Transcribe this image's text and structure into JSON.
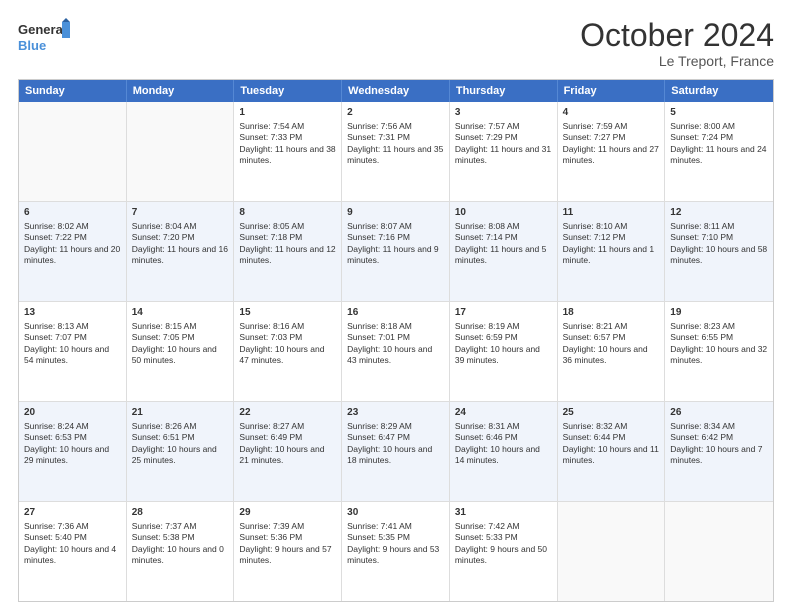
{
  "header": {
    "logo_general": "General",
    "logo_blue": "Blue",
    "month_title": "October 2024",
    "location": "Le Treport, France"
  },
  "days_of_week": [
    "Sunday",
    "Monday",
    "Tuesday",
    "Wednesday",
    "Thursday",
    "Friday",
    "Saturday"
  ],
  "weeks": [
    [
      {
        "day": "",
        "info": ""
      },
      {
        "day": "",
        "info": ""
      },
      {
        "day": "1",
        "sunrise": "Sunrise: 7:54 AM",
        "sunset": "Sunset: 7:33 PM",
        "daylight": "Daylight: 11 hours and 38 minutes."
      },
      {
        "day": "2",
        "sunrise": "Sunrise: 7:56 AM",
        "sunset": "Sunset: 7:31 PM",
        "daylight": "Daylight: 11 hours and 35 minutes."
      },
      {
        "day": "3",
        "sunrise": "Sunrise: 7:57 AM",
        "sunset": "Sunset: 7:29 PM",
        "daylight": "Daylight: 11 hours and 31 minutes."
      },
      {
        "day": "4",
        "sunrise": "Sunrise: 7:59 AM",
        "sunset": "Sunset: 7:27 PM",
        "daylight": "Daylight: 11 hours and 27 minutes."
      },
      {
        "day": "5",
        "sunrise": "Sunrise: 8:00 AM",
        "sunset": "Sunset: 7:24 PM",
        "daylight": "Daylight: 11 hours and 24 minutes."
      }
    ],
    [
      {
        "day": "6",
        "sunrise": "Sunrise: 8:02 AM",
        "sunset": "Sunset: 7:22 PM",
        "daylight": "Daylight: 11 hours and 20 minutes."
      },
      {
        "day": "7",
        "sunrise": "Sunrise: 8:04 AM",
        "sunset": "Sunset: 7:20 PM",
        "daylight": "Daylight: 11 hours and 16 minutes."
      },
      {
        "day": "8",
        "sunrise": "Sunrise: 8:05 AM",
        "sunset": "Sunset: 7:18 PM",
        "daylight": "Daylight: 11 hours and 12 minutes."
      },
      {
        "day": "9",
        "sunrise": "Sunrise: 8:07 AM",
        "sunset": "Sunset: 7:16 PM",
        "daylight": "Daylight: 11 hours and 9 minutes."
      },
      {
        "day": "10",
        "sunrise": "Sunrise: 8:08 AM",
        "sunset": "Sunset: 7:14 PM",
        "daylight": "Daylight: 11 hours and 5 minutes."
      },
      {
        "day": "11",
        "sunrise": "Sunrise: 8:10 AM",
        "sunset": "Sunset: 7:12 PM",
        "daylight": "Daylight: 11 hours and 1 minute."
      },
      {
        "day": "12",
        "sunrise": "Sunrise: 8:11 AM",
        "sunset": "Sunset: 7:10 PM",
        "daylight": "Daylight: 10 hours and 58 minutes."
      }
    ],
    [
      {
        "day": "13",
        "sunrise": "Sunrise: 8:13 AM",
        "sunset": "Sunset: 7:07 PM",
        "daylight": "Daylight: 10 hours and 54 minutes."
      },
      {
        "day": "14",
        "sunrise": "Sunrise: 8:15 AM",
        "sunset": "Sunset: 7:05 PM",
        "daylight": "Daylight: 10 hours and 50 minutes."
      },
      {
        "day": "15",
        "sunrise": "Sunrise: 8:16 AM",
        "sunset": "Sunset: 7:03 PM",
        "daylight": "Daylight: 10 hours and 47 minutes."
      },
      {
        "day": "16",
        "sunrise": "Sunrise: 8:18 AM",
        "sunset": "Sunset: 7:01 PM",
        "daylight": "Daylight: 10 hours and 43 minutes."
      },
      {
        "day": "17",
        "sunrise": "Sunrise: 8:19 AM",
        "sunset": "Sunset: 6:59 PM",
        "daylight": "Daylight: 10 hours and 39 minutes."
      },
      {
        "day": "18",
        "sunrise": "Sunrise: 8:21 AM",
        "sunset": "Sunset: 6:57 PM",
        "daylight": "Daylight: 10 hours and 36 minutes."
      },
      {
        "day": "19",
        "sunrise": "Sunrise: 8:23 AM",
        "sunset": "Sunset: 6:55 PM",
        "daylight": "Daylight: 10 hours and 32 minutes."
      }
    ],
    [
      {
        "day": "20",
        "sunrise": "Sunrise: 8:24 AM",
        "sunset": "Sunset: 6:53 PM",
        "daylight": "Daylight: 10 hours and 29 minutes."
      },
      {
        "day": "21",
        "sunrise": "Sunrise: 8:26 AM",
        "sunset": "Sunset: 6:51 PM",
        "daylight": "Daylight: 10 hours and 25 minutes."
      },
      {
        "day": "22",
        "sunrise": "Sunrise: 8:27 AM",
        "sunset": "Sunset: 6:49 PM",
        "daylight": "Daylight: 10 hours and 21 minutes."
      },
      {
        "day": "23",
        "sunrise": "Sunrise: 8:29 AM",
        "sunset": "Sunset: 6:47 PM",
        "daylight": "Daylight: 10 hours and 18 minutes."
      },
      {
        "day": "24",
        "sunrise": "Sunrise: 8:31 AM",
        "sunset": "Sunset: 6:46 PM",
        "daylight": "Daylight: 10 hours and 14 minutes."
      },
      {
        "day": "25",
        "sunrise": "Sunrise: 8:32 AM",
        "sunset": "Sunset: 6:44 PM",
        "daylight": "Daylight: 10 hours and 11 minutes."
      },
      {
        "day": "26",
        "sunrise": "Sunrise: 8:34 AM",
        "sunset": "Sunset: 6:42 PM",
        "daylight": "Daylight: 10 hours and 7 minutes."
      }
    ],
    [
      {
        "day": "27",
        "sunrise": "Sunrise: 7:36 AM",
        "sunset": "Sunset: 5:40 PM",
        "daylight": "Daylight: 10 hours and 4 minutes."
      },
      {
        "day": "28",
        "sunrise": "Sunrise: 7:37 AM",
        "sunset": "Sunset: 5:38 PM",
        "daylight": "Daylight: 10 hours and 0 minutes."
      },
      {
        "day": "29",
        "sunrise": "Sunrise: 7:39 AM",
        "sunset": "Sunset: 5:36 PM",
        "daylight": "Daylight: 9 hours and 57 minutes."
      },
      {
        "day": "30",
        "sunrise": "Sunrise: 7:41 AM",
        "sunset": "Sunset: 5:35 PM",
        "daylight": "Daylight: 9 hours and 53 minutes."
      },
      {
        "day": "31",
        "sunrise": "Sunrise: 7:42 AM",
        "sunset": "Sunset: 5:33 PM",
        "daylight": "Daylight: 9 hours and 50 minutes."
      },
      {
        "day": "",
        "info": ""
      },
      {
        "day": "",
        "info": ""
      }
    ]
  ]
}
